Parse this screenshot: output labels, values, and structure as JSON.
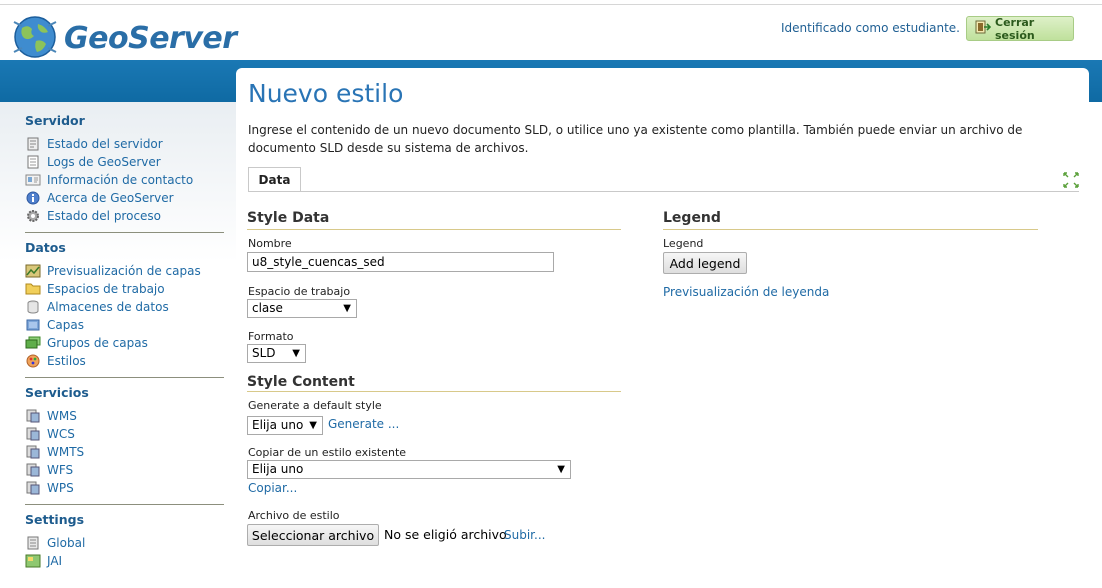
{
  "header": {
    "logo_text": "GeoServer",
    "login_text": "Identificado como estudiante.",
    "logout_label": "Cerrar sesión"
  },
  "sidebar": {
    "sections": [
      {
        "title": "Servidor",
        "items": [
          {
            "label": "Estado del servidor",
            "icon": "server-status-icon"
          },
          {
            "label": "Logs de GeoServer",
            "icon": "logs-icon"
          },
          {
            "label": "Información de contacto",
            "icon": "contact-card-icon"
          },
          {
            "label": "Acerca de GeoServer",
            "icon": "info-icon"
          },
          {
            "label": "Estado del proceso",
            "icon": "gear-icon"
          }
        ]
      },
      {
        "title": "Datos",
        "items": [
          {
            "label": "Previsualización de capas",
            "icon": "layer-preview-icon"
          },
          {
            "label": "Espacios de trabajo",
            "icon": "folder-icon"
          },
          {
            "label": "Almacenes de datos",
            "icon": "database-icon"
          },
          {
            "label": "Capas",
            "icon": "layer-icon"
          },
          {
            "label": "Grupos de capas",
            "icon": "layer-group-icon"
          },
          {
            "label": "Estilos",
            "icon": "palette-icon"
          }
        ]
      },
      {
        "title": "Servicios",
        "items": [
          {
            "label": "WMS",
            "icon": "service-icon"
          },
          {
            "label": "WCS",
            "icon": "service-icon"
          },
          {
            "label": "WMTS",
            "icon": "service-icon"
          },
          {
            "label": "WFS",
            "icon": "service-icon"
          },
          {
            "label": "WPS",
            "icon": "service-icon"
          }
        ]
      },
      {
        "title": "Settings",
        "items": [
          {
            "label": "Global",
            "icon": "settings-doc-icon"
          },
          {
            "label": "JAI",
            "icon": "jai-icon"
          }
        ]
      }
    ]
  },
  "main": {
    "title": "Nuevo estilo",
    "description": "Ingrese el contenido de un nuevo documento SLD, o utilice uno ya existente como plantilla. También puede enviar un archivo de documento SLD desde su sistema de archivos.",
    "tab_label": "Data",
    "style_data": {
      "heading": "Style Data",
      "name_label": "Nombre",
      "name_value": "u8_style_cuencas_sed",
      "workspace_label": "Espacio de trabajo",
      "workspace_value": "clase",
      "format_label": "Formato",
      "format_value": "SLD"
    },
    "style_content": {
      "heading": "Style Content",
      "generate_label": "Generate a default style",
      "generate_value": "Elija uno",
      "generate_link": "Generate ...",
      "copy_label": "Copiar de un estilo existente",
      "copy_value": "Elija uno",
      "copy_link": "Copiar...",
      "file_label": "Archivo de estilo",
      "file_button": "Seleccionar archivo",
      "file_status": "No se eligió archivo",
      "upload_link": "Subir..."
    },
    "legend": {
      "heading": "Legend",
      "label": "Legend",
      "add_button": "Add legend",
      "preview_link": "Previsualización de leyenda"
    }
  },
  "colors": {
    "band": "#1a78b4",
    "link": "#1f6aa5",
    "title": "#2974b5",
    "section_title": "#1e5c8e"
  }
}
